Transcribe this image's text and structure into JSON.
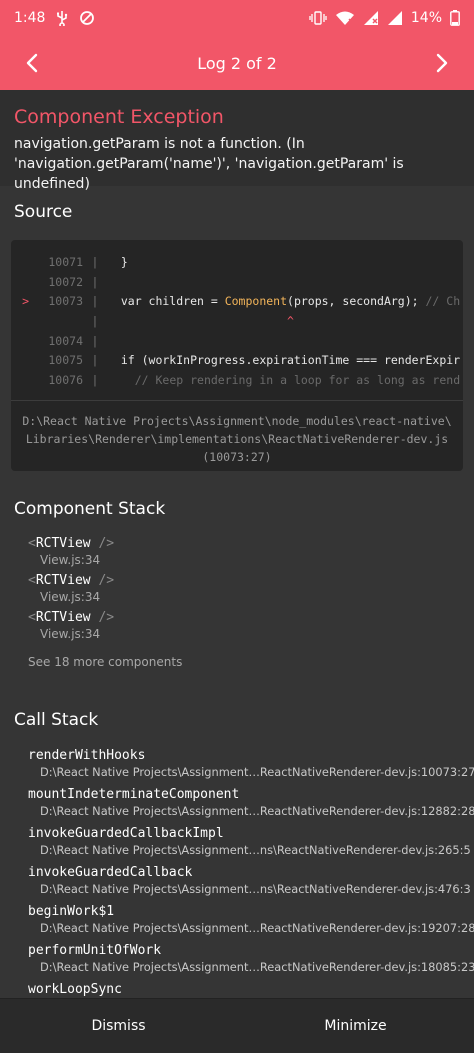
{
  "status_bar": {
    "time": "1:48",
    "battery": "14%"
  },
  "header": {
    "title": "Log 2 of 2"
  },
  "exception": {
    "title": "Component Exception",
    "message": "navigation.getParam is not a function. (In 'navigation.getParam('name')', 'navigation.getParam' is undefined)"
  },
  "source": {
    "title": "Source",
    "lines": [
      {
        "marker": "",
        "num": "10071",
        "code_a": "  }",
        "code_b": "",
        "code_c": "",
        "code_d": ""
      },
      {
        "marker": "",
        "num": "10072",
        "code_a": "",
        "code_b": "",
        "code_c": "",
        "code_d": ""
      },
      {
        "marker": ">",
        "num": "10073",
        "code_a": "  var children = ",
        "code_b": "Component",
        "code_c": "(props, secondArg); ",
        "code_d": "// Ch"
      },
      {
        "marker": "",
        "num": "",
        "code_a": "                          ^",
        "code_b": "",
        "code_c": "",
        "code_d": ""
      },
      {
        "marker": "",
        "num": "10074",
        "code_a": "",
        "code_b": "",
        "code_c": "",
        "code_d": ""
      },
      {
        "marker": "",
        "num": "10075",
        "code_a": "  if (workInProgress.expirationTime === renderExpir",
        "code_b": "",
        "code_c": "",
        "code_d": ""
      },
      {
        "marker": "",
        "num": "10076",
        "code_a": "    ",
        "code_b": "",
        "code_c": "",
        "code_d": "// Keep rendering in a loop for as long as rend"
      }
    ],
    "path_line1": "D:\\React Native Projects\\Assignment\\node_modules\\react-native\\",
    "path_line2": "Libraries\\Renderer\\implementations\\ReactNativeRenderer-dev.js",
    "path_line3": "(10073:27)"
  },
  "component_stack": {
    "title": "Component Stack",
    "items": [
      {
        "open": "<",
        "name": "RCTView",
        "close": " />",
        "file": "View.js:34"
      },
      {
        "open": "<",
        "name": "RCTView",
        "close": " />",
        "file": "View.js:34"
      },
      {
        "open": "<",
        "name": "RCTView",
        "close": " />",
        "file": "View.js:34"
      }
    ],
    "see_more": "See 18 more components"
  },
  "call_stack": {
    "title": "Call Stack",
    "items": [
      {
        "name": "renderWithHooks",
        "file": "D:\\React Native Projects\\Assignment…ReactNativeRenderer-dev.js:10073:27"
      },
      {
        "name": "mountIndeterminateComponent",
        "file": "D:\\React Native Projects\\Assignment…ReactNativeRenderer-dev.js:12882:28"
      },
      {
        "name": "invokeGuardedCallbackImpl",
        "file": "D:\\React Native Projects\\Assignment…ns\\ReactNativeRenderer-dev.js:265:5"
      },
      {
        "name": "invokeGuardedCallback",
        "file": "D:\\React Native Projects\\Assignment…ns\\ReactNativeRenderer-dev.js:476:3"
      },
      {
        "name": "beginWork$1",
        "file": "D:\\React Native Projects\\Assignment…ReactNativeRenderer-dev.js:19207:28"
      },
      {
        "name": "performUnitOfWork",
        "file": "D:\\React Native Projects\\Assignment…ReactNativeRenderer-dev.js:18085:23"
      },
      {
        "name": "workLoopSync",
        "file": ""
      }
    ]
  },
  "footer": {
    "dismiss": "Dismiss",
    "minimize": "Minimize"
  },
  "colors": {
    "accent": "#f25668",
    "background": "#353535",
    "code_bg": "#252525"
  }
}
